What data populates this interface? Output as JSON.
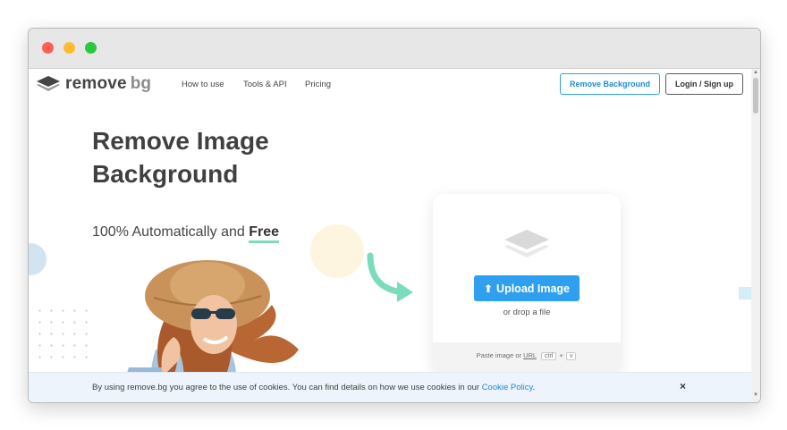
{
  "nav": {
    "logo_primary": "remove",
    "logo_secondary": "bg",
    "links": [
      "How to use",
      "Tools & API",
      "Pricing"
    ],
    "remove_background_label": "Remove Background",
    "login_label": "Login / Sign up"
  },
  "hero": {
    "title_line1": "Remove Image",
    "title_line2": "Background",
    "subtitle_prefix": "100% Automatically and ",
    "subtitle_emphasis": "Free"
  },
  "upload": {
    "button_label": "Upload Image",
    "drop_text": "or drop a file",
    "paste_prefix": "Paste image or ",
    "paste_url": "URL",
    "key_ctrl": "ctrl",
    "key_plus": "+",
    "key_v": "v"
  },
  "cookie": {
    "text": "By using remove.bg you agree to the use of cookies. You can find details on how we use cookies in our ",
    "link": "Cookie Policy",
    "suffix": ".",
    "close": "×"
  },
  "colors": {
    "accent": "#2f9ff0",
    "free_underline": "#7bdcbc",
    "cookie_bg": "#eef4fb"
  },
  "icons": [
    "close-icon",
    "minimize-icon",
    "maximize-icon",
    "layers-logo-icon",
    "upload-icon",
    "arrow-icon"
  ]
}
